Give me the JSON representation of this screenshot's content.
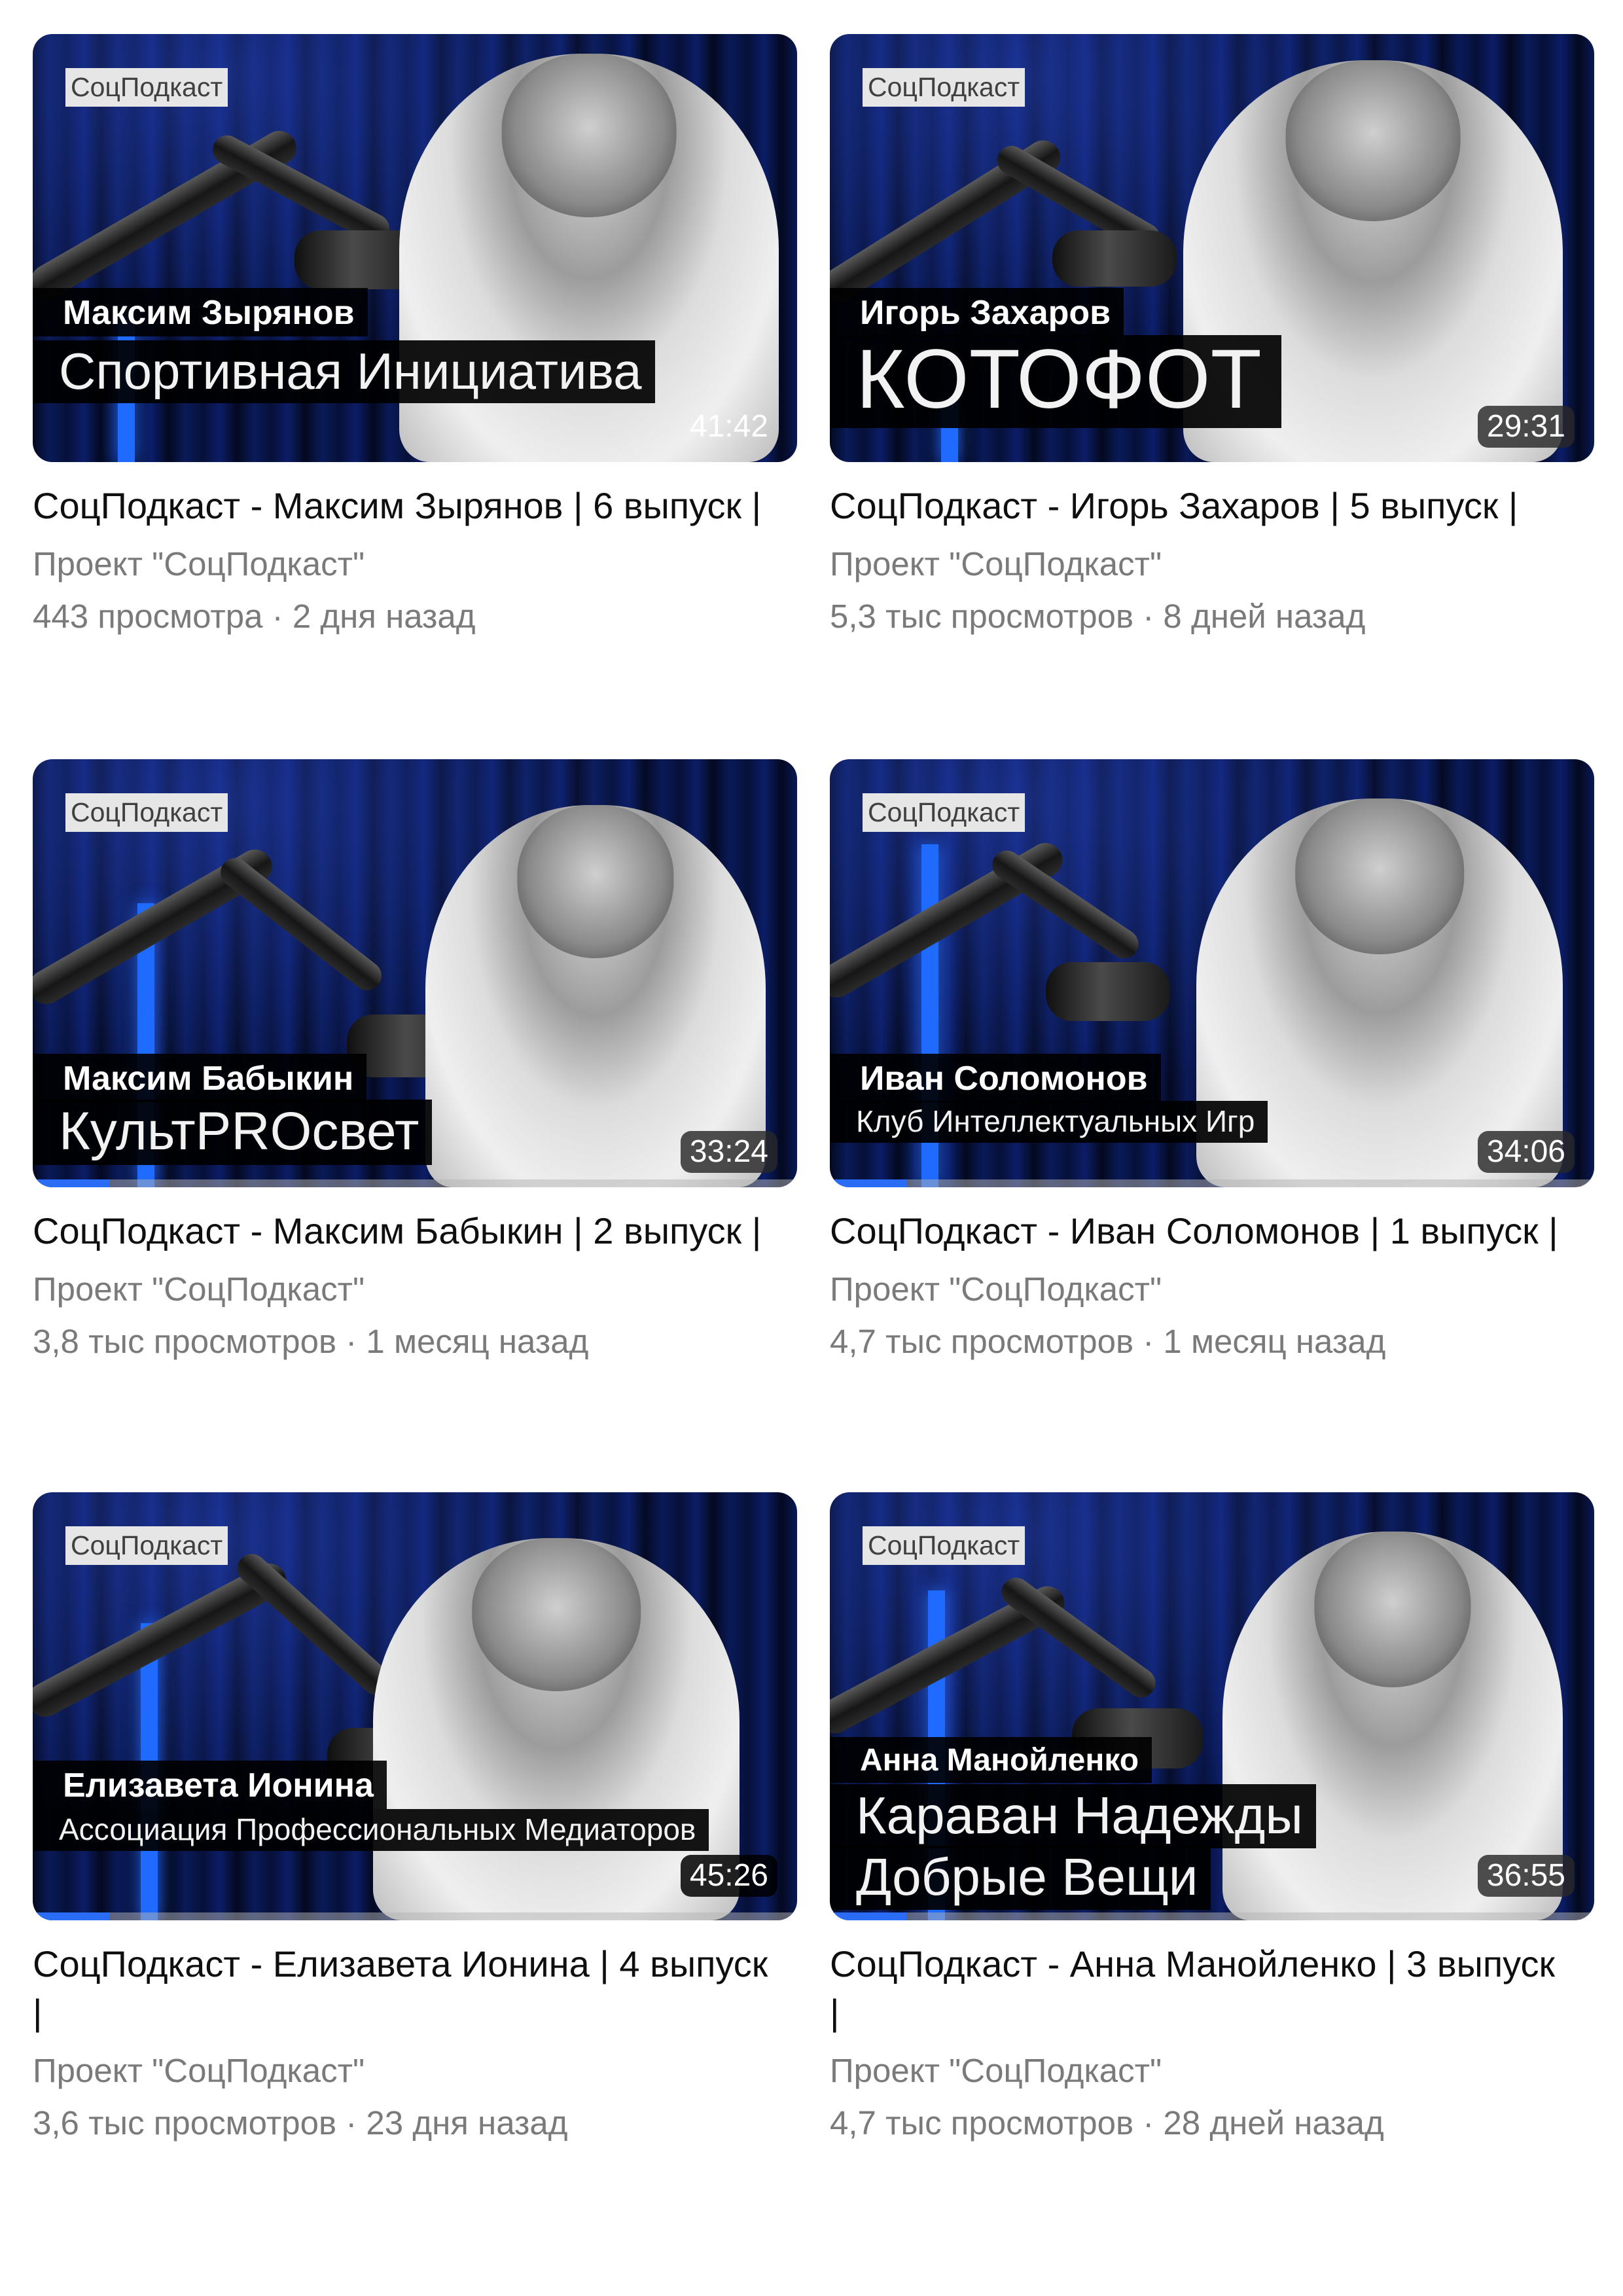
{
  "colors": {
    "accent_blue": "#2a6cf5",
    "title_text": "#0f0f0f",
    "meta_text": "#7a7a7a"
  },
  "videos": [
    {
      "brand": "СоцПодкаст",
      "overlay_name": "Максим Зырянов",
      "overlay_org": "Спортивная Инициатива",
      "duration": "41:42",
      "title": "СоцПодкаст - Максим Зырянов | 6 выпуск |",
      "channel": "Проект \"СоцПодкаст\"",
      "views": "443 просмотра",
      "separator": "·",
      "age": "2 дня назад",
      "watched_fraction": 0
    },
    {
      "brand": "СоцПодкаст",
      "overlay_name": "Игорь Захаров",
      "overlay_org": "КОТОФОТ",
      "duration": "29:31",
      "title": "СоцПодкаст - Игорь Захаров | 5 выпуск |",
      "channel": "Проект \"СоцПодкаст\"",
      "views": "5,3 тыс просмотров",
      "separator": "·",
      "age": "8 дней назад",
      "watched_fraction": 0
    },
    {
      "brand": "СоцПодкаст",
      "overlay_name": "Максим Бабыкин",
      "overlay_org": "КультPROсвет",
      "duration": "33:24",
      "title": "СоцПодкаст - Максим Бабыкин | 2 выпуск |",
      "channel": "Проект \"СоцПодкаст\"",
      "views": "3,8 тыс просмотров",
      "separator": "·",
      "age": "1 месяц назад",
      "watched_fraction": 0.1
    },
    {
      "brand": "СоцПодкаст",
      "overlay_name": "Иван Соломонов",
      "overlay_org": "Клуб Интеллектуальных Игр",
      "duration": "34:06",
      "title": "СоцПодкаст - Иван Соломонов | 1 выпуск |",
      "channel": "Проект \"СоцПодкаст\"",
      "views": "4,7 тыс просмотров",
      "separator": "·",
      "age": "1 месяц назад",
      "watched_fraction": 0.1
    },
    {
      "brand": "СоцПодкаст",
      "overlay_name": "Елизавета Ионина",
      "overlay_org": "Ассоциация Профессиональных Медиаторов",
      "duration": "45:26",
      "title": "СоцПодкаст - Елизавета Ионина | 4 выпуск |",
      "channel": "Проект \"СоцПодкаст\"",
      "views": "3,6 тыс просмотров",
      "separator": "·",
      "age": "23 дня назад",
      "watched_fraction": 0.1
    },
    {
      "brand": "СоцПодкаст",
      "overlay_name": "Анна Манойленко",
      "overlay_org": "Караван Надежды",
      "overlay_org_line2": "Добрые Вещи",
      "duration": "36:55",
      "title": "СоцПодкаст - Анна Манойленко | 3 выпуск |",
      "channel": "Проект \"СоцПодкаст\"",
      "views": "4,7 тыс просмотров",
      "separator": "·",
      "age": "28 дней назад",
      "watched_fraction": 0.1
    }
  ]
}
